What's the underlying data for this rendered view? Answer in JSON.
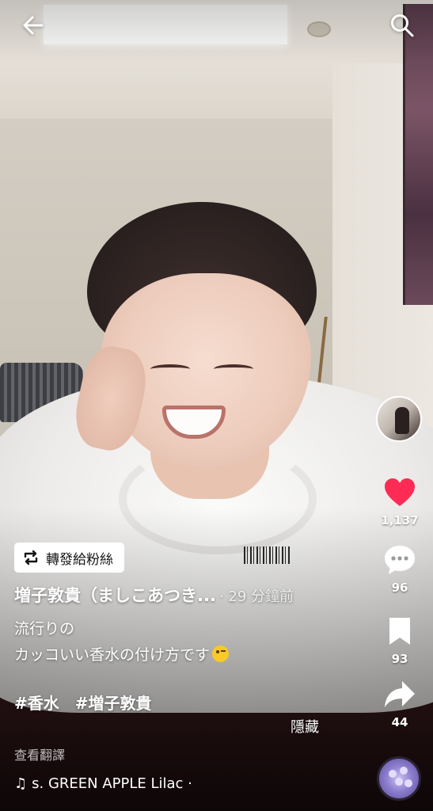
{
  "top_bar": {
    "back_icon": "arrow-left-icon",
    "search_icon": "search-icon"
  },
  "rail": {
    "likes": "1,137",
    "comments": "96",
    "saves": "93",
    "shares": "44",
    "like_color": "#fe2c55"
  },
  "post": {
    "repost_label": "轉發給粉絲",
    "author": "増子敦貴（ましこあつき...",
    "time": "· 29 分鐘前",
    "caption_line1": "流行りの",
    "caption_line2": "カッコいい香水の付け方です",
    "hashtags": [
      "#香水",
      "#増子敦貴"
    ],
    "hide_label": "隱藏",
    "translate_label": "查看翻譯",
    "music": "s. GREEN APPLE   Lilac ·"
  }
}
